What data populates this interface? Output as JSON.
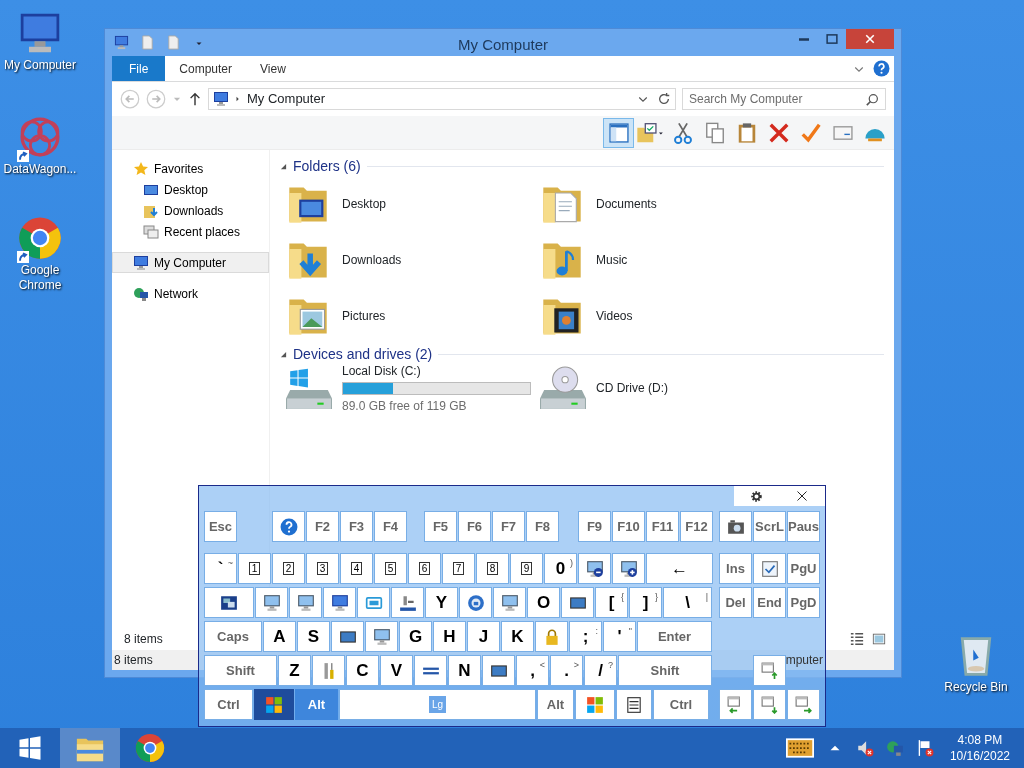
{
  "desktop_icons": [
    {
      "label": "My Computer",
      "kind": "computer",
      "shortcut": false
    },
    {
      "label": "DataWagon...",
      "kind": "app",
      "shortcut": true
    },
    {
      "label": "Google Chrome",
      "kind": "chrome",
      "shortcut": true
    },
    {
      "label": "Recycle Bin",
      "kind": "recycle",
      "shortcut": false
    }
  ],
  "explorer": {
    "title": "My Computer",
    "quick_access": [
      {
        "kind": "computer"
      },
      {
        "kind": "page"
      },
      {
        "kind": "page"
      },
      {
        "kind": "caret"
      }
    ],
    "ribbon_tabs": [
      {
        "label": "File",
        "selected": true
      },
      {
        "label": "Computer",
        "selected": false
      },
      {
        "label": "View",
        "selected": false
      }
    ],
    "address": "My Computer",
    "search": {
      "placeholder": "Search My Computer"
    },
    "toolbar": [
      {
        "kind": "pane",
        "selected": true
      },
      {
        "kind": "folder-check",
        "selected": false
      },
      {
        "kind": "scissors",
        "selected": false
      },
      {
        "kind": "copy",
        "selected": false
      },
      {
        "kind": "paste",
        "selected": false
      },
      {
        "kind": "delete",
        "selected": false
      },
      {
        "kind": "check",
        "selected": false
      },
      {
        "kind": "card",
        "selected": false
      },
      {
        "kind": "shell",
        "selected": false
      }
    ],
    "nav": [
      {
        "label": "Favorites",
        "kind": "star",
        "selected": false,
        "children": [
          {
            "label": "Desktop",
            "kind": "desktop",
            "selected": false
          },
          {
            "label": "Downloads",
            "kind": "downloads",
            "selected": false
          },
          {
            "label": "Recent places",
            "kind": "recent",
            "selected": false
          }
        ]
      },
      {
        "label": "My Computer",
        "kind": "computer",
        "selected": true
      },
      {
        "label": "Network",
        "kind": "network",
        "selected": false
      }
    ],
    "groups": [
      {
        "title": "Folders (6)",
        "items": [
          {
            "label": "Desktop",
            "kind": "desktop"
          },
          {
            "label": "Documents",
            "kind": "documents"
          },
          {
            "label": "Downloads",
            "kind": "downloads"
          },
          {
            "label": "Music",
            "kind": "music"
          },
          {
            "label": "Pictures",
            "kind": "pictures"
          },
          {
            "label": "Videos",
            "kind": "videos"
          }
        ]
      },
      {
        "title": "Devices and drives (2)",
        "items": [
          {
            "label": "Local Disk (C:)",
            "kind": "disk",
            "level": 0.27,
            "detail": "89.0 GB free of 119 GB"
          },
          {
            "label": "CD Drive (D:)",
            "kind": "cd"
          }
        ]
      }
    ],
    "details": "8 items",
    "status_bar": {
      "items": "8 items",
      "location": "mputer"
    }
  },
  "keyboard": {
    "main_rows": [
      [
        {
          "kind": "fn",
          "label": "Esc",
          "pressed": false
        },
        {
          "kind": "help",
          "pressed": false
        },
        {
          "kind": "fn",
          "label": "F2",
          "pressed": false
        },
        {
          "kind": "fn",
          "label": "F3",
          "pressed": false
        },
        {
          "kind": "fn",
          "label": "F4",
          "pressed": false
        },
        {
          "kind": "fn",
          "label": "F5",
          "pressed": false
        },
        {
          "kind": "fn",
          "label": "F6",
          "pressed": false
        },
        {
          "kind": "fn",
          "label": "F7",
          "pressed": false
        },
        {
          "kind": "fn",
          "label": "F8",
          "pressed": false
        },
        {
          "kind": "fn",
          "label": "F9",
          "pressed": false
        },
        {
          "kind": "fn",
          "label": "F10",
          "pressed": false
        },
        {
          "kind": "fn",
          "label": "F11",
          "pressed": false
        },
        {
          "kind": "fn",
          "label": "F12",
          "pressed": false
        }
      ],
      [
        {
          "kind": "char",
          "label": "`",
          "shift": "~",
          "pressed": false
        },
        {
          "kind": "boxed",
          "label": "1",
          "pressed": false
        },
        {
          "kind": "boxed",
          "label": "2",
          "pressed": false
        },
        {
          "kind": "boxed",
          "label": "3",
          "pressed": false
        },
        {
          "kind": "boxed",
          "label": "4",
          "pressed": false
        },
        {
          "kind": "boxed",
          "label": "5",
          "pressed": false
        },
        {
          "kind": "boxed",
          "label": "6",
          "pressed": false
        },
        {
          "kind": "boxed",
          "label": "7",
          "pressed": false
        },
        {
          "kind": "boxed",
          "label": "8",
          "pressed": false
        },
        {
          "kind": "boxed",
          "label": "9",
          "pressed": false
        },
        {
          "kind": "char",
          "label": "0",
          "shift": ")",
          "pressed": false
        },
        {
          "kind": "zoom-out",
          "pressed": false
        },
        {
          "kind": "zoom-in",
          "pressed": false
        },
        {
          "kind": "char",
          "label": "←",
          "pressed": false
        }
      ],
      [
        {
          "kind": "windows-stack",
          "pressed": false
        },
        {
          "kind": "monitor",
          "pressed": false
        },
        {
          "kind": "monitor",
          "pressed": false
        },
        {
          "kind": "computer",
          "pressed": false
        },
        {
          "kind": "frame",
          "pressed": false
        },
        {
          "kind": "tray",
          "pressed": false
        },
        {
          "kind": "char",
          "label": "Y",
          "pressed": false
        },
        {
          "kind": "globe",
          "pressed": false
        },
        {
          "kind": "monitor",
          "pressed": false
        },
        {
          "kind": "char",
          "label": "O",
          "pressed": false
        },
        {
          "kind": "screen",
          "pressed": false
        },
        {
          "kind": "char",
          "label": "[",
          "shift": "{",
          "pressed": false
        },
        {
          "kind": "char",
          "label": "]",
          "shift": "}",
          "pressed": false
        },
        {
          "kind": "char",
          "label": "\\",
          "shift": "|",
          "pressed": false
        }
      ],
      [
        {
          "kind": "fn",
          "label": "Caps",
          "pressed": false
        },
        {
          "kind": "char",
          "label": "A",
          "pressed": false
        },
        {
          "kind": "char",
          "label": "S",
          "pressed": false
        },
        {
          "kind": "screen",
          "pressed": false
        },
        {
          "kind": "monitor",
          "pressed": false
        },
        {
          "kind": "char",
          "label": "G",
          "pressed": false
        },
        {
          "kind": "char",
          "label": "H",
          "pressed": false
        },
        {
          "kind": "char",
          "label": "J",
          "pressed": false
        },
        {
          "kind": "char",
          "label": "K",
          "pressed": false
        },
        {
          "kind": "lock",
          "pressed": false
        },
        {
          "kind": "char",
          "label": ";",
          "shift": ":",
          "pressed": false
        },
        {
          "kind": "char",
          "label": "'",
          "shift": "\"",
          "pressed": false
        },
        {
          "kind": "fn",
          "label": "Enter",
          "pressed": false
        }
      ],
      [
        {
          "kind": "fn",
          "label": "Shift",
          "pressed": false
        },
        {
          "kind": "char",
          "label": "Z",
          "pressed": false
        },
        {
          "kind": "tools",
          "pressed": false
        },
        {
          "kind": "char",
          "label": "C",
          "pressed": false
        },
        {
          "kind": "char",
          "label": "V",
          "pressed": false
        },
        {
          "kind": "bars",
          "pressed": false
        },
        {
          "kind": "char",
          "label": "N",
          "pressed": false
        },
        {
          "kind": "screen",
          "pressed": false
        },
        {
          "kind": "char",
          "label": ",",
          "shift": "<",
          "pressed": false
        },
        {
          "kind": "char",
          "label": ".",
          "shift": ">",
          "pressed": false
        },
        {
          "kind": "char",
          "label": "/",
          "shift": "?",
          "pressed": false
        },
        {
          "kind": "fn",
          "label": "Shift",
          "pressed": false
        }
      ],
      [
        {
          "kind": "fn",
          "label": "Ctrl",
          "pressed": false
        },
        {
          "kind": "windows",
          "pressed": true
        },
        {
          "kind": "fn",
          "label": "Alt",
          "pressed": true
        },
        {
          "kind": "space",
          "label": "Lg",
          "pressed": false
        },
        {
          "kind": "fn",
          "label": "Alt",
          "pressed": false
        },
        {
          "kind": "windows",
          "pressed": false
        },
        {
          "kind": "menu",
          "pressed": false
        },
        {
          "kind": "fn",
          "label": "Ctrl",
          "pressed": false
        }
      ]
    ],
    "nav_rows": [
      [
        {
          "kind": "camera",
          "pressed": false
        },
        {
          "kind": "fn",
          "label": "ScrL",
          "pressed": false
        },
        {
          "kind": "fn",
          "label": "Paus",
          "pressed": false
        }
      ],
      [
        {
          "kind": "fn",
          "label": "Ins",
          "pressed": false
        },
        {
          "kind": "check",
          "pressed": false
        },
        {
          "kind": "fn",
          "label": "PgU",
          "pressed": false
        }
      ],
      [
        {
          "kind": "fn",
          "label": "Del",
          "pressed": false
        },
        {
          "kind": "fn",
          "label": "End",
          "pressed": false
        },
        {
          "kind": "fn",
          "label": "PgD",
          "pressed": false
        }
      ]
    ],
    "arrow_keys": [
      {
        "kind": "win-up",
        "pressed": false
      },
      {
        "kind": "win-left",
        "pressed": false
      },
      {
        "kind": "win-down",
        "pressed": false
      },
      {
        "kind": "win-right",
        "pressed": false
      }
    ]
  },
  "taskbar": {
    "apps": [
      {
        "kind": "start",
        "selected": false
      },
      {
        "kind": "explorer",
        "selected": true
      },
      {
        "kind": "chrome",
        "selected": false
      }
    ],
    "tray": [
      {
        "kind": "keyboard"
      },
      {
        "kind": "caret-up"
      },
      {
        "kind": "speaker-muted"
      },
      {
        "kind": "network"
      },
      {
        "kind": "flag"
      }
    ],
    "time": "4:08 PM",
    "date": "10/16/2022"
  }
}
